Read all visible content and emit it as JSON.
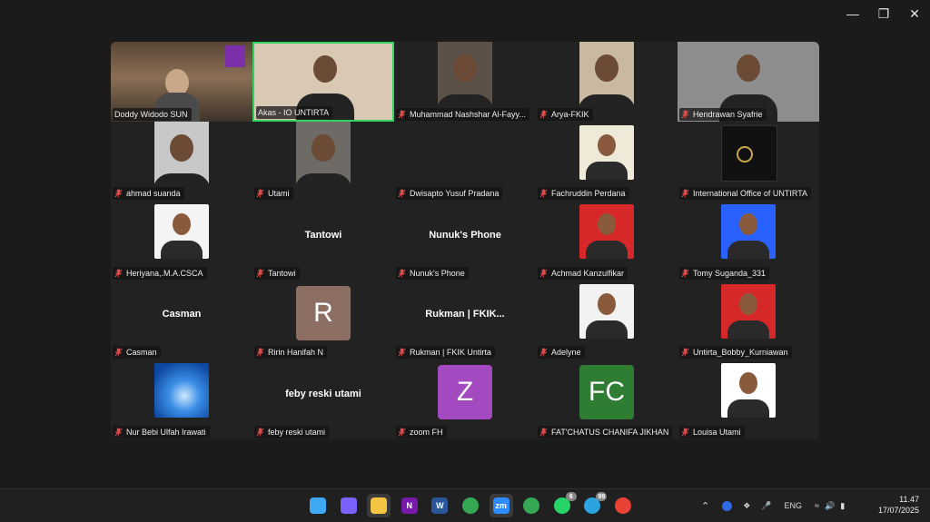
{
  "window": {
    "controls": [
      "minimize",
      "restore",
      "close"
    ]
  },
  "participants": [
    {
      "name": "Doddy Widodo SUN",
      "muted": false,
      "type": "video-room"
    },
    {
      "name": "Akas - IO UNTIRTA",
      "muted": false,
      "type": "video",
      "active": true
    },
    {
      "name": "Muhammad Nashshar Al-Fayy...",
      "muted": true,
      "type": "video"
    },
    {
      "name": "Arya-FKIK",
      "muted": true,
      "type": "video"
    },
    {
      "name": "Hendrawan Syafrie",
      "muted": true,
      "type": "video"
    },
    {
      "name": "ahmad suanda",
      "muted": true,
      "type": "video"
    },
    {
      "name": "Utami",
      "muted": true,
      "type": "video"
    },
    {
      "name": "Dwisapto Yusuf Pradana",
      "muted": true,
      "type": "blank"
    },
    {
      "name": "Fachruddin Perdana",
      "muted": true,
      "type": "photo"
    },
    {
      "name": "International Office of UNTIRTA",
      "muted": true,
      "type": "logo"
    },
    {
      "name": "Heriyana,.M.A.CSCA",
      "muted": true,
      "type": "photo"
    },
    {
      "name": "Tantowi",
      "muted": true,
      "type": "text",
      "display": "Tantowi"
    },
    {
      "name": "Nunuk's Phone",
      "muted": true,
      "type": "text",
      "display": "Nunuk's Phone"
    },
    {
      "name": "Achmad Kanzulfikar",
      "muted": true,
      "type": "photo"
    },
    {
      "name": "Tomy Suganda_331",
      "muted": true,
      "type": "photo"
    },
    {
      "name": "Casman",
      "muted": true,
      "type": "text",
      "display": "Casman"
    },
    {
      "name": "Ririn Hanifah N",
      "muted": true,
      "type": "avatar",
      "letter": "R",
      "color": "#8d6e63"
    },
    {
      "name": "Rukman | FKIK Untirta",
      "muted": true,
      "type": "text",
      "display": "Rukman | FKIK..."
    },
    {
      "name": "Adelyne",
      "muted": true,
      "type": "photo"
    },
    {
      "name": "Untirta_Bobby_Kurniawan",
      "muted": true,
      "type": "photo"
    },
    {
      "name": "Nur Bebi Ulfah Irawati",
      "muted": true,
      "type": "wallpaper"
    },
    {
      "name": "feby reski utami",
      "muted": true,
      "type": "text",
      "display": "feby reski utami"
    },
    {
      "name": "zoom FH",
      "muted": true,
      "type": "avatar",
      "letter": "Z",
      "color": "#a44ac1"
    },
    {
      "name": "FAT'CHATUS CHANIFA JIKHAN",
      "muted": true,
      "type": "avatar",
      "letter": "FC",
      "color": "#2e7d32"
    },
    {
      "name": "Louisa Utami",
      "muted": true,
      "type": "photo"
    }
  ],
  "taskbar": {
    "apps": [
      {
        "name": "windows-start",
        "label": ""
      },
      {
        "name": "copilot",
        "label": ""
      },
      {
        "name": "file-explorer",
        "label": ""
      },
      {
        "name": "onenote",
        "label": "N"
      },
      {
        "name": "word",
        "label": "W"
      },
      {
        "name": "chrome",
        "label": ""
      },
      {
        "name": "zoom",
        "label": "zm"
      },
      {
        "name": "chrome-profile",
        "label": ""
      },
      {
        "name": "whatsapp",
        "label": "",
        "badge": "6"
      },
      {
        "name": "telegram",
        "label": "",
        "badge": "99"
      },
      {
        "name": "chrome-profile-2",
        "label": ""
      }
    ],
    "tray": {
      "language": "ENG",
      "time": "11.47",
      "date": "17/07/2025"
    }
  }
}
